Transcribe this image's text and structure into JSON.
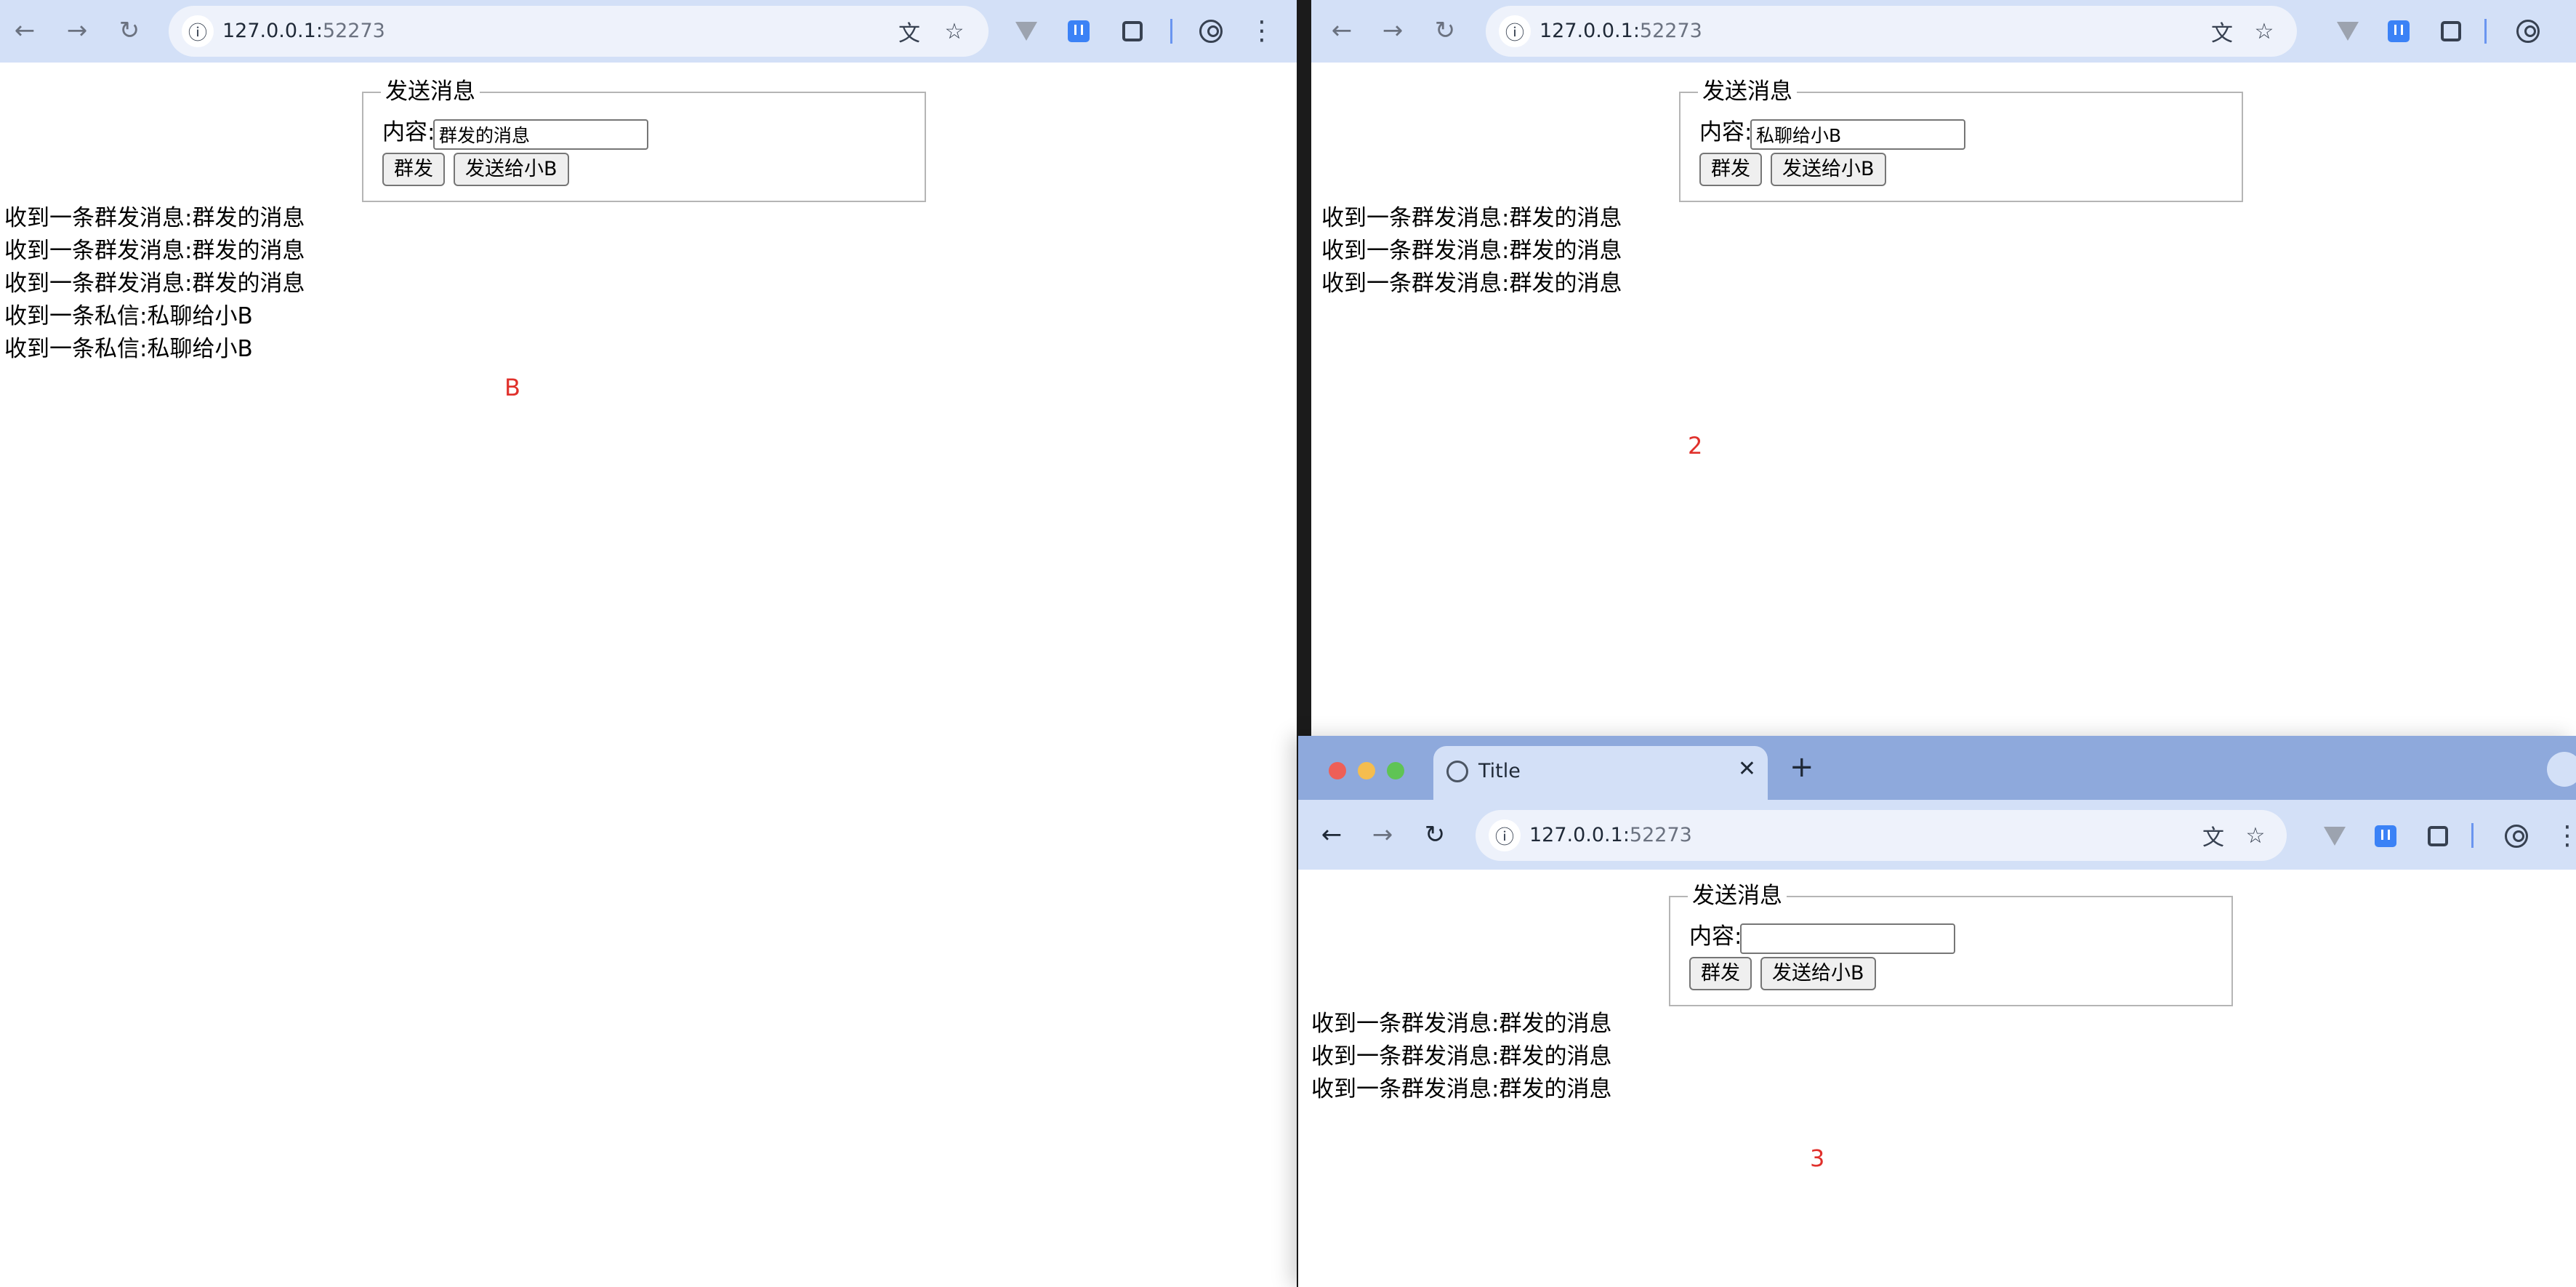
{
  "url": {
    "host": "127.0.0.1:",
    "port": "52273"
  },
  "tab_title": "Title",
  "form": {
    "legend": "发送消息",
    "content_label": "内容:",
    "broadcast_button": "群发",
    "private_button": "发送给小B"
  },
  "windows": [
    {
      "input_value": "群发的消息",
      "messages": [
        "收到一条群发消息:群发的消息",
        "收到一条群发消息:群发的消息",
        "收到一条群发消息:群发的消息",
        "收到一条私信:私聊给小B",
        "收到一条私信:私聊给小B"
      ],
      "marker": "B"
    },
    {
      "input_value": "私聊给小B",
      "messages": [
        "收到一条群发消息:群发的消息",
        "收到一条群发消息:群发的消息",
        "收到一条群发消息:群发的消息"
      ],
      "marker": "2"
    },
    {
      "input_value": "",
      "messages": [
        "收到一条群发消息:群发的消息",
        "收到一条群发消息:群发的消息",
        "收到一条群发消息:群发的消息"
      ],
      "marker": "3"
    }
  ],
  "colors": {
    "marker": "#e0302b",
    "toolbar": "#d3e0f7",
    "tabbar": "#8ea9dc"
  }
}
